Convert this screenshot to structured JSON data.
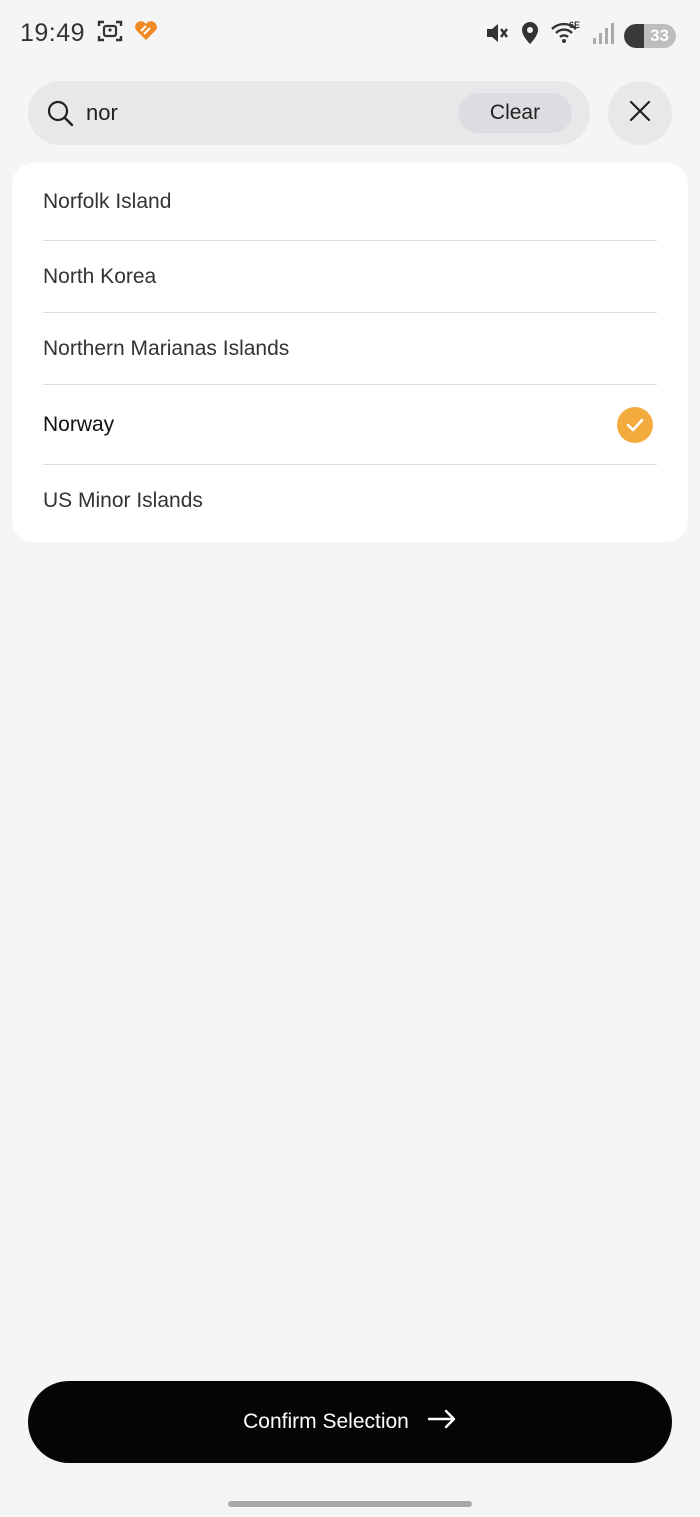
{
  "status_bar": {
    "time": "19:49",
    "battery_level": "33",
    "left_icons": [
      "screenshot-icon",
      "app-heart-icon"
    ],
    "right_icons": [
      "mute-icon",
      "location-icon",
      "wifi-6e-icon",
      "signal-icon",
      "battery-icon"
    ],
    "wifi_label": "6E"
  },
  "search": {
    "value": "nor",
    "clear_label": "Clear"
  },
  "results": [
    {
      "label": "Norfolk Island",
      "selected": false
    },
    {
      "label": "North Korea",
      "selected": false
    },
    {
      "label": "Northern Marianas Islands",
      "selected": false
    },
    {
      "label": "Norway",
      "selected": true
    },
    {
      "label": "US Minor Islands",
      "selected": false
    }
  ],
  "confirm": {
    "label": "Confirm Selection"
  },
  "colors": {
    "accent": "#f4ab3d",
    "background": "#f5f5f5",
    "button": "#050505",
    "app_icon": "#f08a24"
  }
}
